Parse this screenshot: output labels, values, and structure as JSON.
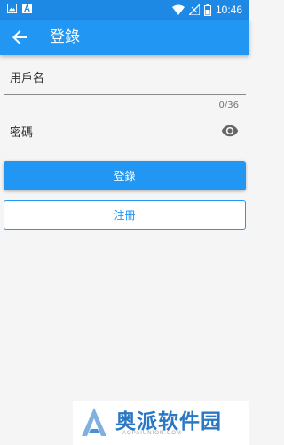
{
  "status_bar": {
    "time": "10:46",
    "icons": [
      "image-icon",
      "text-icon",
      "wifi-icon",
      "signal-icon",
      "battery-icon"
    ]
  },
  "app_bar": {
    "title": "登錄",
    "back_icon": "arrow-back-icon"
  },
  "form": {
    "username_label": "用戶名",
    "password_label": "密碼",
    "password_counter": "0/36",
    "visibility_icon": "eye-icon"
  },
  "buttons": {
    "login": "登錄",
    "register": "注冊"
  },
  "watermark": {
    "text": "奥派软件园",
    "sub": "AOPAIUNION.COM"
  },
  "colors": {
    "primary": "#2196f3",
    "status_bar": "#1e88e5",
    "background": "#f5f5f5"
  }
}
